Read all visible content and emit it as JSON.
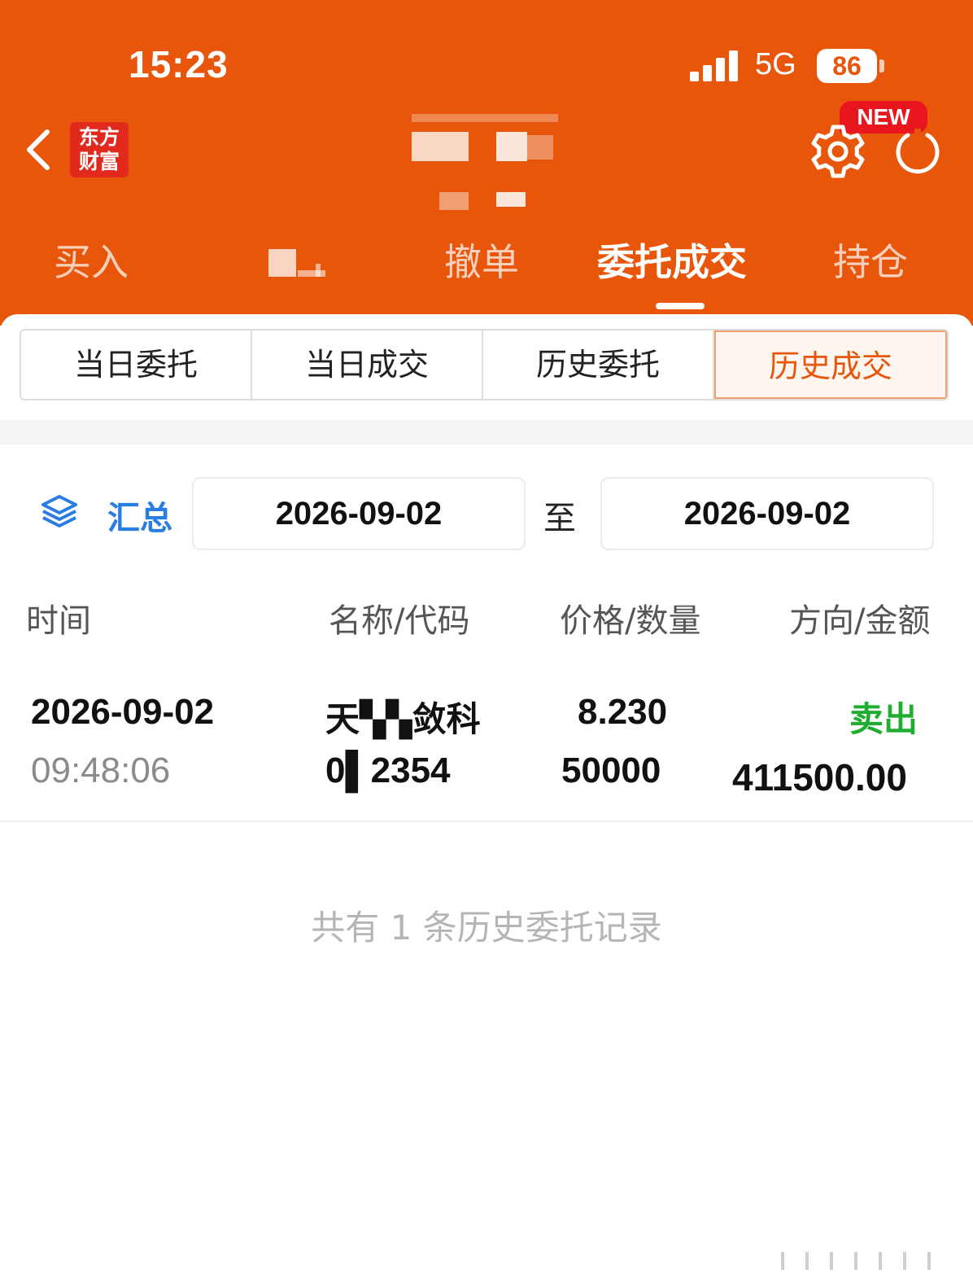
{
  "status_bar": {
    "time": "15:23",
    "network": "5G",
    "battery": "86"
  },
  "header": {
    "logo_text_line1": "东方",
    "logo_text_line2": "财富",
    "new_badge": "NEW"
  },
  "main_tabs": [
    {
      "label": "买入"
    },
    {
      "label": "撤单"
    },
    {
      "label": "委托成交",
      "active": true
    },
    {
      "label": "持仓"
    }
  ],
  "sub_tabs": [
    {
      "label": "当日委托"
    },
    {
      "label": "当日成交"
    },
    {
      "label": "历史委托"
    },
    {
      "label": "历史成交",
      "active": true
    }
  ],
  "filter": {
    "summary_label": "汇总",
    "start_date": "2026-09-02",
    "separator": "至",
    "end_date": "2026-09-02"
  },
  "columns": [
    "时间",
    "名称/代码",
    "价格/数量",
    "方向/金额"
  ],
  "rows": [
    {
      "date": "2026-09-02",
      "time": "09:48:06",
      "name": "天▚▚敛科",
      "code": "0▌2354",
      "price": "8.230",
      "quantity": "50000",
      "direction": "卖出",
      "amount": "411500.00"
    }
  ],
  "footer_note": "共有 1 条历史委托记录",
  "colors": {
    "header": "#e8560b",
    "accent_blue": "#2a7de1",
    "sell_green": "#1fae2f",
    "active_orange": "#e8560b"
  }
}
